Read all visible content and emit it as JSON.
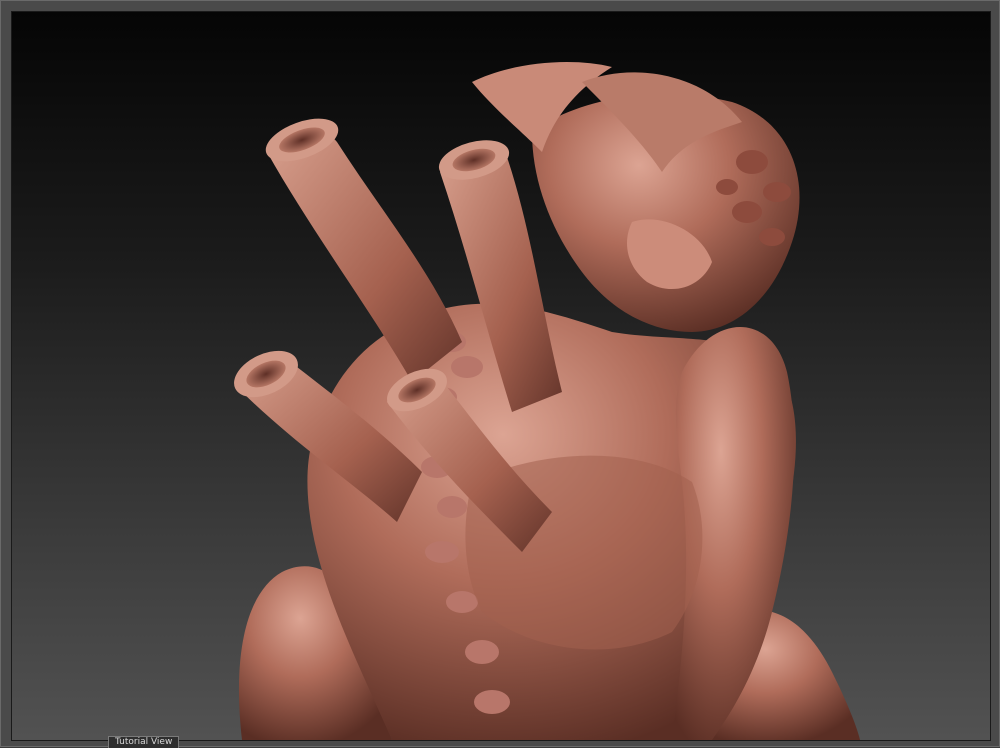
{
  "window": {
    "view_label": "Tutorial View"
  },
  "viewport": {
    "model_icon": "sculpt-model",
    "colors": {
      "background_top": "#050505",
      "background_bottom": "#525252",
      "clay_light": "#d79a86",
      "clay_mid": "#a86452",
      "clay_dark": "#5a2e24"
    }
  }
}
